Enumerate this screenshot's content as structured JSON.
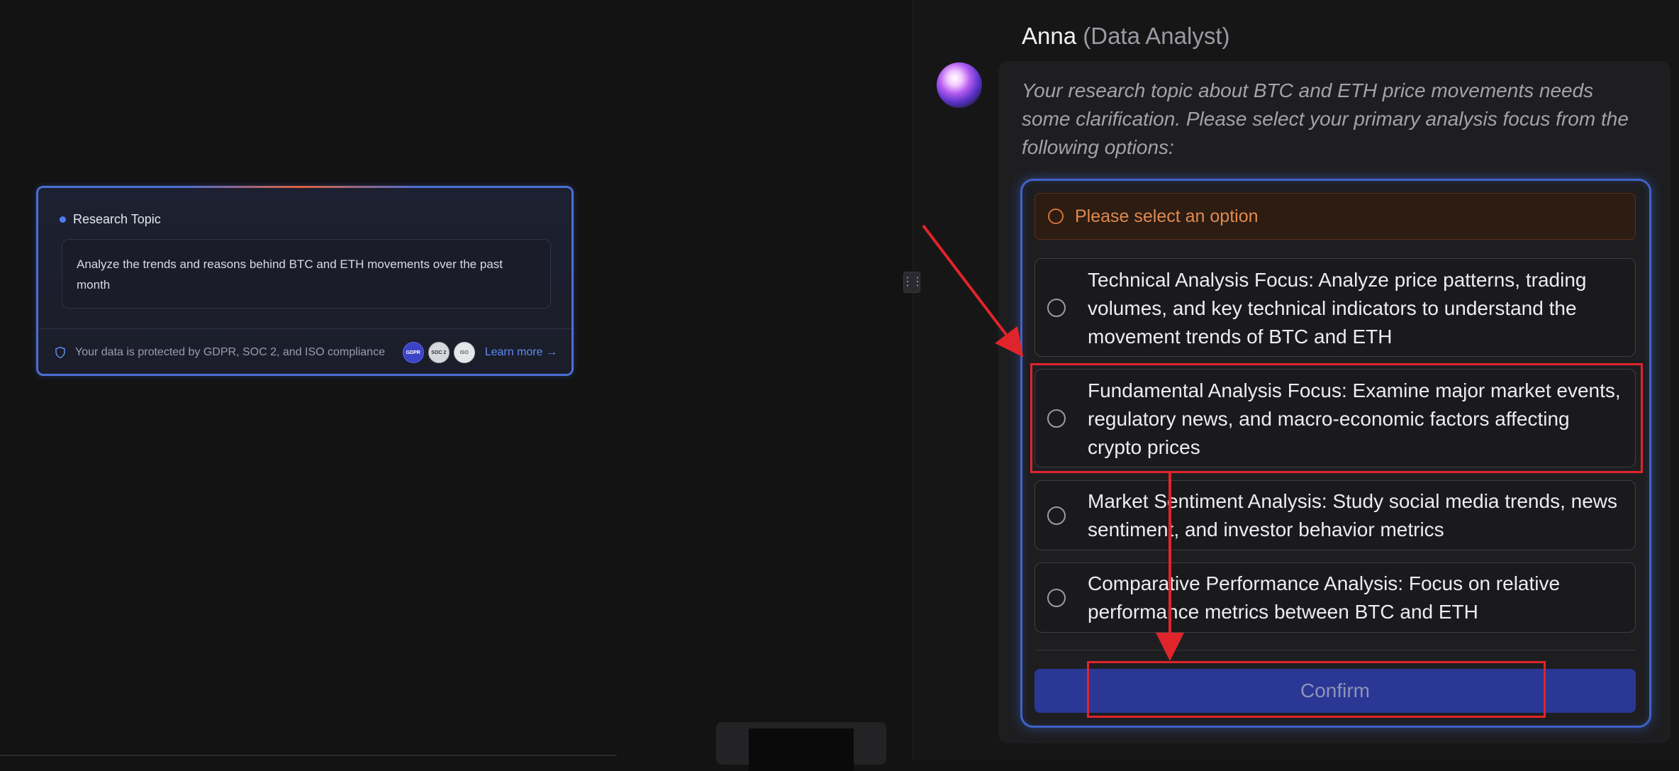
{
  "research_card": {
    "label": "Research Topic",
    "topic_text": "Analyze the trends and reasons behind BTC and ETH movements over the past month",
    "compliance_text": "Your data is protected by GDPR, SOC 2, and ISO compliance",
    "badges": [
      "GDPR",
      "SOC 2",
      "ISO"
    ],
    "learn_more": "Learn more →"
  },
  "chat": {
    "agent_name": "Anna",
    "agent_role": "(Data Analyst)",
    "message": "Your research topic about BTC and ETH price movements needs some clarification. Please select your primary analysis focus from the following options:",
    "warning": "Please select an option",
    "options": [
      {
        "label": "Technical Analysis Focus: Analyze price patterns, trading volumes, and key technical indicators to understand the movement trends of BTC and ETH",
        "selected": false
      },
      {
        "label": "Fundamental Analysis Focus: Examine major market events, regulatory news, and macro-economic factors affecting crypto prices",
        "selected": false
      },
      {
        "label": "Market Sentiment Analysis: Study social media trends, news sentiment, and investor behavior metrics",
        "selected": false
      },
      {
        "label": "Comparative Performance Analysis: Focus on relative performance metrics between BTC and ETH",
        "selected": false
      }
    ],
    "confirm_label": "Confirm"
  },
  "colors": {
    "accent_blue": "#3e63c9",
    "warning_orange": "#e0894f",
    "annotation_red": "#e0242b",
    "confirm_bg": "#2b3795"
  }
}
